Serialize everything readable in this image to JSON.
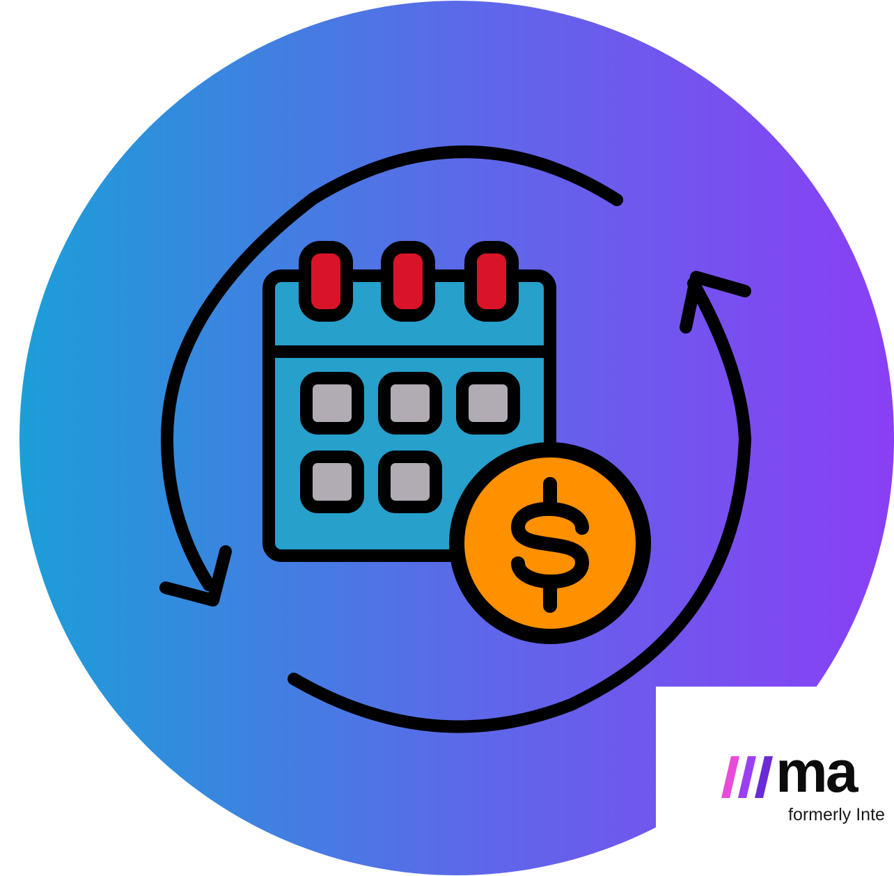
{
  "illustration": {
    "icon_name": "recurring-payment-calendar-icon",
    "parts": [
      "calendar-icon",
      "dollar-coin-icon",
      "cycle-arrows-icon"
    ],
    "colors": {
      "gradient_start": "#1c9ed8",
      "gradient_mid": "#5b6ae8",
      "gradient_end": "#8a3ff5",
      "calendar_body": "#28a0cc",
      "calendar_rings": "#d91428",
      "calendar_cells": "#b1acb3",
      "coin": "#ff9000",
      "outline": "#000000"
    }
  },
  "logo": {
    "word": "ma",
    "tagline": "formerly Inte",
    "colors": {
      "stripe_1": "#e94bd8",
      "stripe_2": "#9a3ff2",
      "stripe_3": "#6a2ad8",
      "text": "#0b0b0b"
    }
  }
}
